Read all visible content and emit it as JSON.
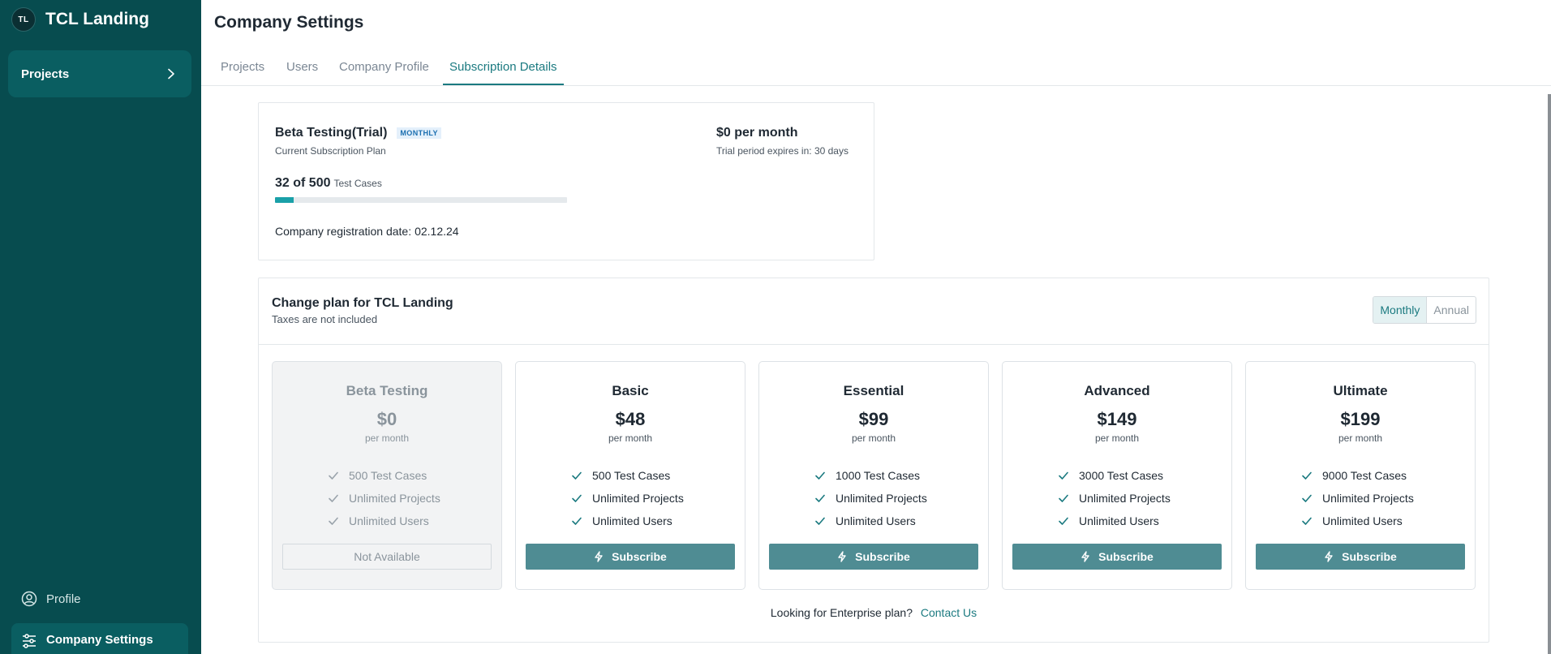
{
  "brand": {
    "initials": "TL",
    "name": "TCL Landing"
  },
  "sidebar": {
    "projects_label": "Projects",
    "profile_label": "Profile",
    "company_settings_label": "Company Settings"
  },
  "page": {
    "title": "Company Settings",
    "tabs": [
      {
        "label": "Projects",
        "active": false
      },
      {
        "label": "Users",
        "active": false
      },
      {
        "label": "Company Profile",
        "active": false
      },
      {
        "label": "Subscription Details",
        "active": true
      }
    ]
  },
  "current_plan": {
    "name": "Beta Testing(Trial)",
    "badge": "MONTHLY",
    "subtitle": "Current Subscription Plan",
    "price": "$0 per month",
    "trial_text": "Trial period expires in: 30 days",
    "usage_text": "32 of 500",
    "usage_unit": "Test Cases",
    "usage_used": 32,
    "usage_total": 500,
    "registration_label": "Company registration date:",
    "registration_date": "02.12.24"
  },
  "change_plan": {
    "title": "Change plan for TCL Landing",
    "subtitle": "Taxes are not included",
    "billing_options": [
      "Monthly",
      "Annual"
    ],
    "billing_selected": "Monthly",
    "plans": [
      {
        "name": "Beta Testing",
        "price": "$0",
        "period": "per month",
        "features": [
          "500 Test Cases",
          "Unlimited Projects",
          "Unlimited Users"
        ],
        "button": "Not Available",
        "available": false
      },
      {
        "name": "Basic",
        "price": "$48",
        "period": "per month",
        "features": [
          "500 Test Cases",
          "Unlimited Projects",
          "Unlimited Users"
        ],
        "button": "Subscribe",
        "available": true
      },
      {
        "name": "Essential",
        "price": "$99",
        "period": "per month",
        "features": [
          "1000 Test Cases",
          "Unlimited Projects",
          "Unlimited Users"
        ],
        "button": "Subscribe",
        "available": true
      },
      {
        "name": "Advanced",
        "price": "$149",
        "period": "per month",
        "features": [
          "3000 Test Cases",
          "Unlimited Projects",
          "Unlimited Users"
        ],
        "button": "Subscribe",
        "available": true
      },
      {
        "name": "Ultimate",
        "price": "$199",
        "period": "per month",
        "features": [
          "9000 Test Cases",
          "Unlimited Projects",
          "Unlimited Users"
        ],
        "button": "Subscribe",
        "available": true
      }
    ],
    "enterprise_text": "Looking for Enterprise plan?",
    "contact_label": "Contact Us"
  },
  "colors": {
    "sidebar_bg": "#074c4f",
    "accent": "#1b7a80",
    "button": "#4f8c93",
    "progress": "#1aa0a8",
    "badge": "#1b6fb0"
  },
  "icons": {
    "chevron": "chevron-right-icon",
    "profile": "user-circle-icon",
    "settings": "sliders-icon",
    "check": "check-icon",
    "subscribe": "lightning-icon"
  }
}
